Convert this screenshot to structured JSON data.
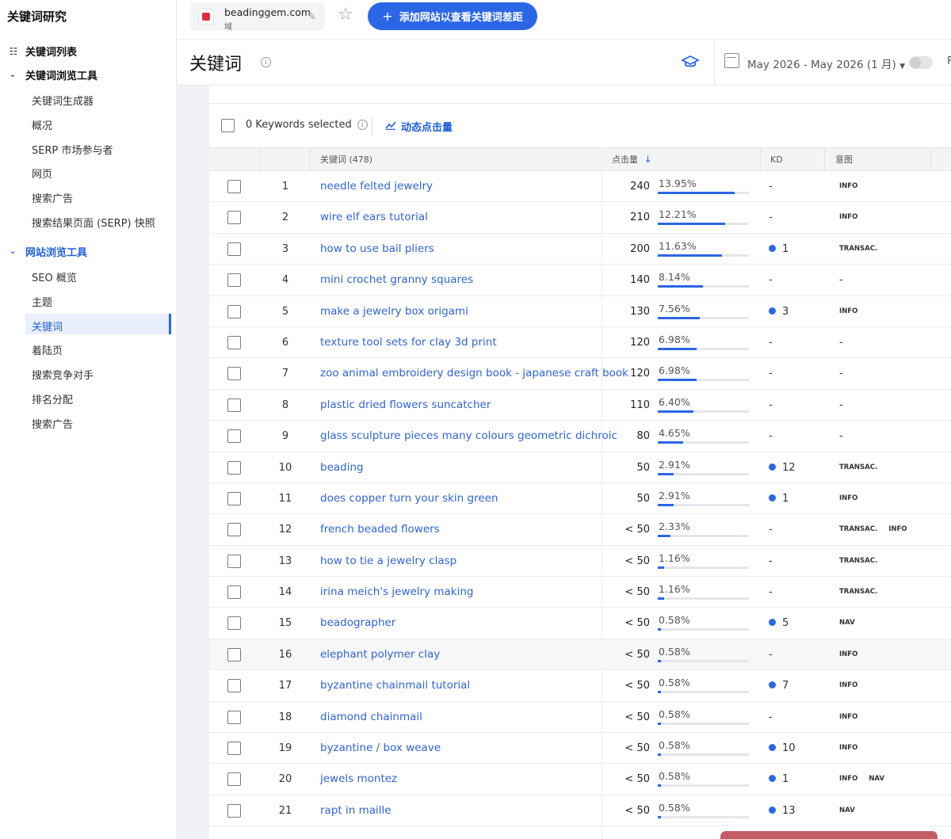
{
  "sidebar": {
    "title": "关键词研究",
    "keyword_list": "关键词列表",
    "keyword_explorer": "关键词浏览工具",
    "explorer_items": [
      "关键词生成器",
      "概况",
      "SERP 市场参与者",
      "网页",
      "搜索广告",
      "搜索结果页面 (SERP) 快照"
    ],
    "site_explorer": "网站浏览工具",
    "site_items": [
      "SEO 概览",
      "主题",
      "关键词",
      "着陆页",
      "搜索竞争对手",
      "排名分配",
      "搜索广告"
    ],
    "active_item": "关键词"
  },
  "header": {
    "domain": "beadinggem.com",
    "domain_sub": "域",
    "add_button": "添加网站以查看关键词差距",
    "page_title": "关键词",
    "date_range": "May 2026 - May 2026 (1 月)",
    "cut_label": "F"
  },
  "toolbar": {
    "selected": "0 Keywords selected",
    "dynamic_clicks": "动态点击量"
  },
  "table": {
    "headers": {
      "keyword": "关键词 (478)",
      "clicks": "点击量",
      "kd": "KD",
      "intent": "意图"
    },
    "rows": [
      {
        "n": "1",
        "keyword": "needle felted jewelry",
        "clicks": "240",
        "pct": "13.95%",
        "share": 13.95,
        "kd": "-",
        "kd_dot": false,
        "intent": [
          "INFO"
        ]
      },
      {
        "n": "2",
        "keyword": "wire elf ears tutorial",
        "clicks": "210",
        "pct": "12.21%",
        "share": 12.21,
        "kd": "-",
        "kd_dot": false,
        "intent": [
          "INFO"
        ]
      },
      {
        "n": "3",
        "keyword": "how to use bail pliers",
        "clicks": "200",
        "pct": "11.63%",
        "share": 11.63,
        "kd": "1",
        "kd_dot": true,
        "intent": [
          "TRANSAC."
        ]
      },
      {
        "n": "4",
        "keyword": "mini crochet granny squares",
        "clicks": "140",
        "pct": "8.14%",
        "share": 8.14,
        "kd": "-",
        "kd_dot": false,
        "intent": [
          "-"
        ]
      },
      {
        "n": "5",
        "keyword": "make a jewelry box origami",
        "clicks": "130",
        "pct": "7.56%",
        "share": 7.56,
        "kd": "3",
        "kd_dot": true,
        "intent": [
          "INFO"
        ]
      },
      {
        "n": "6",
        "keyword": "texture tool sets for clay 3d print",
        "clicks": "120",
        "pct": "6.98%",
        "share": 6.98,
        "kd": "-",
        "kd_dot": false,
        "intent": [
          "-"
        ]
      },
      {
        "n": "7",
        "keyword": "zoo animal embroidery design book - japanese craft book",
        "clicks": "120",
        "pct": "6.98%",
        "share": 6.98,
        "kd": "-",
        "kd_dot": false,
        "intent": [
          "-"
        ]
      },
      {
        "n": "8",
        "keyword": "plastic dried flowers suncatcher",
        "clicks": "110",
        "pct": "6.40%",
        "share": 6.4,
        "kd": "-",
        "kd_dot": false,
        "intent": [
          "-"
        ]
      },
      {
        "n": "9",
        "keyword": "glass sculpture pieces many colours geometric dichroic",
        "clicks": "80",
        "pct": "4.65%",
        "share": 4.65,
        "kd": "-",
        "kd_dot": false,
        "intent": [
          "-"
        ]
      },
      {
        "n": "10",
        "keyword": "beading",
        "clicks": "50",
        "pct": "2.91%",
        "share": 2.91,
        "kd": "12",
        "kd_dot": true,
        "intent": [
          "TRANSAC."
        ]
      },
      {
        "n": "11",
        "keyword": "does copper turn your skin green",
        "clicks": "50",
        "pct": "2.91%",
        "share": 2.91,
        "kd": "1",
        "kd_dot": true,
        "intent": [
          "INFO"
        ]
      },
      {
        "n": "12",
        "keyword": "french beaded flowers",
        "clicks": "< 50",
        "pct": "2.33%",
        "share": 2.33,
        "kd": "-",
        "kd_dot": false,
        "intent": [
          "TRANSAC.",
          "INFO"
        ]
      },
      {
        "n": "13",
        "keyword": "how to tie a jewelry clasp",
        "clicks": "< 50",
        "pct": "1.16%",
        "share": 1.16,
        "kd": "-",
        "kd_dot": false,
        "intent": [
          "TRANSAC."
        ]
      },
      {
        "n": "14",
        "keyword": "irina meich's jewelry making",
        "clicks": "< 50",
        "pct": "1.16%",
        "share": 1.16,
        "kd": "-",
        "kd_dot": false,
        "intent": [
          "TRANSAC."
        ]
      },
      {
        "n": "15",
        "keyword": "beadographer",
        "clicks": "< 50",
        "pct": "0.58%",
        "share": 0.58,
        "kd": "5",
        "kd_dot": true,
        "intent": [
          "NAV"
        ]
      },
      {
        "n": "16",
        "keyword": "elephant polymer clay",
        "clicks": "< 50",
        "pct": "0.58%",
        "share": 0.58,
        "kd": "-",
        "kd_dot": false,
        "intent": [
          "INFO"
        ]
      },
      {
        "n": "17",
        "keyword": "byzantine chainmail tutorial",
        "clicks": "< 50",
        "pct": "0.58%",
        "share": 0.58,
        "kd": "7",
        "kd_dot": true,
        "intent": [
          "INFO"
        ]
      },
      {
        "n": "18",
        "keyword": "diamond chainmail",
        "clicks": "< 50",
        "pct": "0.58%",
        "share": 0.58,
        "kd": "-",
        "kd_dot": false,
        "intent": [
          "INFO"
        ]
      },
      {
        "n": "19",
        "keyword": "byzantine / box weave",
        "clicks": "< 50",
        "pct": "0.58%",
        "share": 0.58,
        "kd": "10",
        "kd_dot": true,
        "intent": [
          "INFO"
        ]
      },
      {
        "n": "20",
        "keyword": "jewels montez",
        "clicks": "< 50",
        "pct": "0.58%",
        "share": 0.58,
        "kd": "1",
        "kd_dot": true,
        "intent": [
          "INFO",
          "NAV"
        ]
      },
      {
        "n": "21",
        "keyword": "rapt in maille",
        "clicks": "< 50",
        "pct": "0.58%",
        "share": 0.58,
        "kd": "13",
        "kd_dot": true,
        "intent": [
          "NAV"
        ]
      }
    ]
  },
  "colors": {
    "accent": "#2b66e6",
    "link": "#2f64d8",
    "sidebar_active_bg": "#e9effc"
  }
}
